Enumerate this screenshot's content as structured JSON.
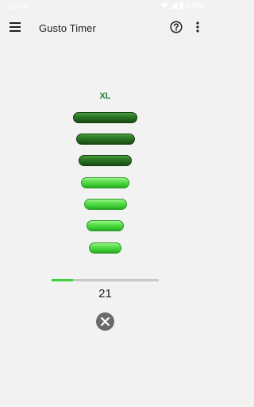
{
  "status_bar": {
    "time": "10:00",
    "battery": "100%"
  },
  "app_bar": {
    "title": "Gusto Timer",
    "icons": [
      "menu-icon",
      "help-icon",
      "more-vert-icon"
    ]
  },
  "timer": {
    "size_label": "XL",
    "bars_total": 7,
    "bars_dark": 3,
    "colors": {
      "dark": "#1f5e1b",
      "light": "#3ccc33",
      "label": "#2e7d32",
      "progress": "#3ed13a"
    },
    "progress_fraction": 0.2,
    "count": "21"
  },
  "cancel": {
    "icon": "close-icon"
  }
}
